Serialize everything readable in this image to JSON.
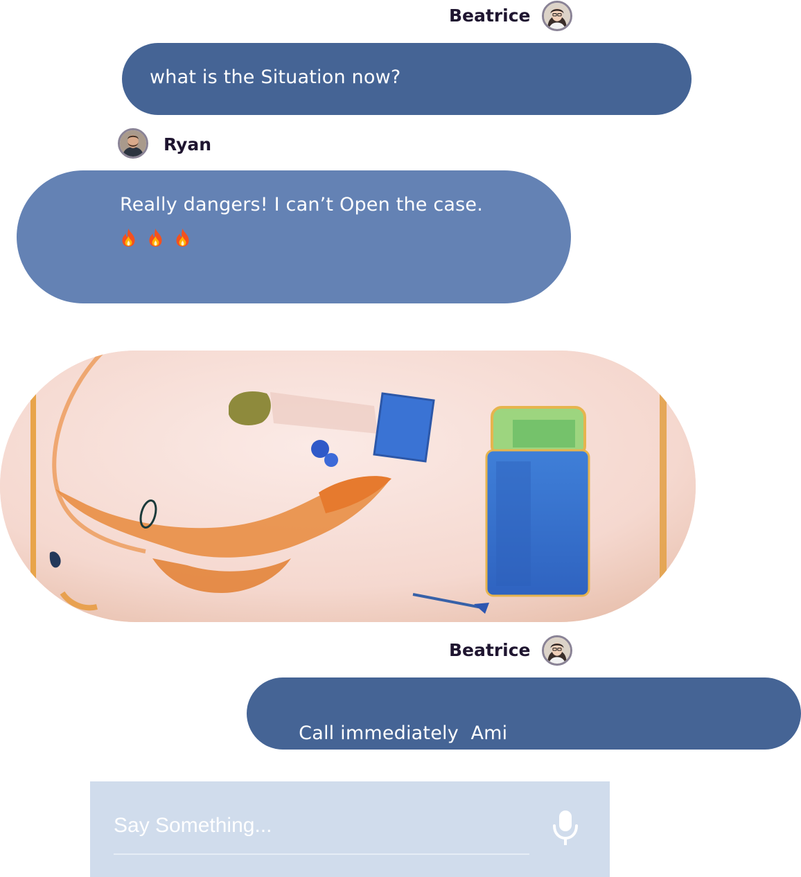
{
  "colors": {
    "outgoing_bubble": "#456495",
    "incoming_bubble": "#6482b4",
    "composer_background": "#d0dcec",
    "sender_name": "#1f1530"
  },
  "messages": [
    {
      "sender": "Beatrice",
      "avatar_icon": "avatar-woman-with-glasses",
      "direction": "outgoing",
      "text": "what is the Situation now?"
    },
    {
      "sender": "Ryan",
      "avatar_icon": "avatar-man-with-beard",
      "direction": "incoming",
      "text": "Really dangers! I can’t Open the case.",
      "emojis": [
        "fire-emoji",
        "fire-emoji",
        "fire-emoji"
      ]
    },
    {
      "type": "image",
      "image_subject": "x-ray scan of a case showing a lizard, phone and other items"
    },
    {
      "sender": "Beatrice",
      "avatar_icon": "avatar-woman-with-glasses",
      "direction": "outgoing",
      "text": "Call immediately  Ami"
    }
  ],
  "composer": {
    "placeholder": "Say Something...",
    "value": "",
    "mic_icon": "microphone-icon"
  }
}
